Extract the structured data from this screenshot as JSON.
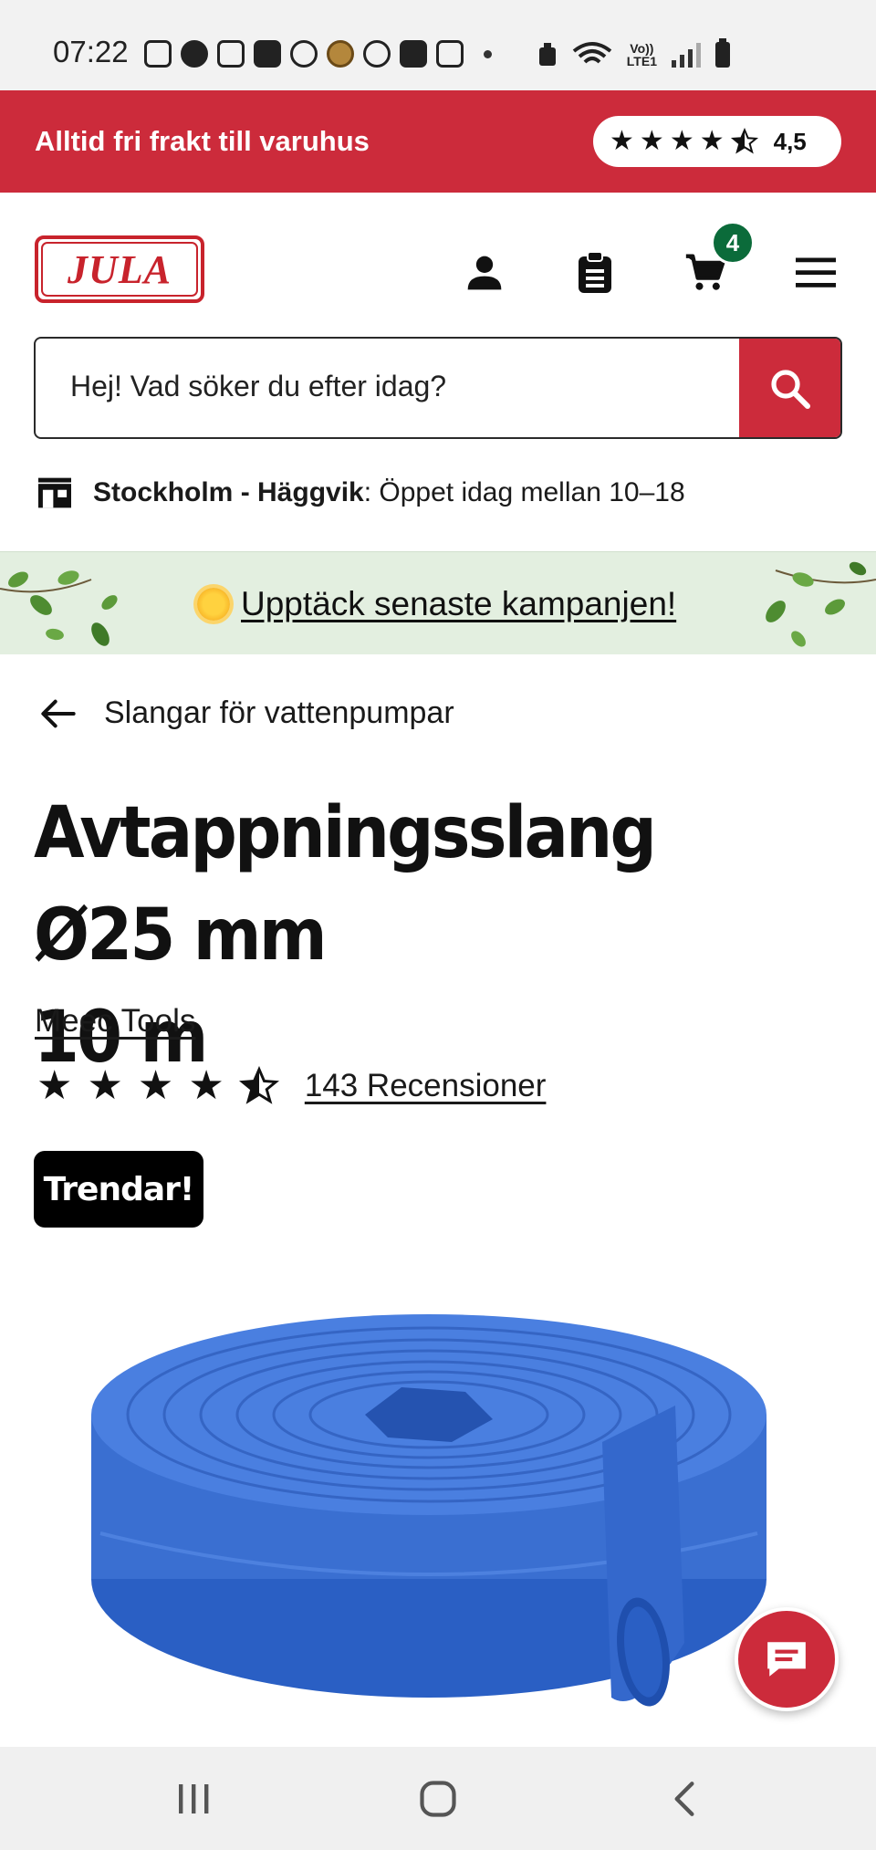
{
  "status_bar": {
    "time": "07:22",
    "network": "Vo))\nLTE1"
  },
  "promo": {
    "text": "Alltid fri frakt till varuhus",
    "rating_value": "4,5",
    "rating": 4.5,
    "rating_max": 5
  },
  "header": {
    "logo_text": "JULA",
    "cart_count": "4",
    "icons": [
      "account-icon",
      "clipboard-icon",
      "cart-icon",
      "menu-icon"
    ]
  },
  "search": {
    "placeholder": "Hej! Vad söker du efter idag?"
  },
  "store": {
    "name": "Stockholm - Häggvik",
    "hours": ": Öppet idag mellan 10–18"
  },
  "campaign": {
    "link_text": "Upptäck senaste kampanjen!"
  },
  "breadcrumb": {
    "label": "Slangar för vattenpumpar"
  },
  "product": {
    "title_line1": "Avtappningsslang Ø25 mm",
    "title_line2": "10 m",
    "brand": "Meec Tools",
    "rating": 4.5,
    "rating_max": 5,
    "reviews_link": "143 Recensioner",
    "tag": "Trendar!",
    "image_color": "#3a6fd1"
  },
  "colors": {
    "brand_red": "#cc2b3b",
    "badge_green": "#0b6b3a",
    "campaign_bg": "#e3efe0"
  }
}
